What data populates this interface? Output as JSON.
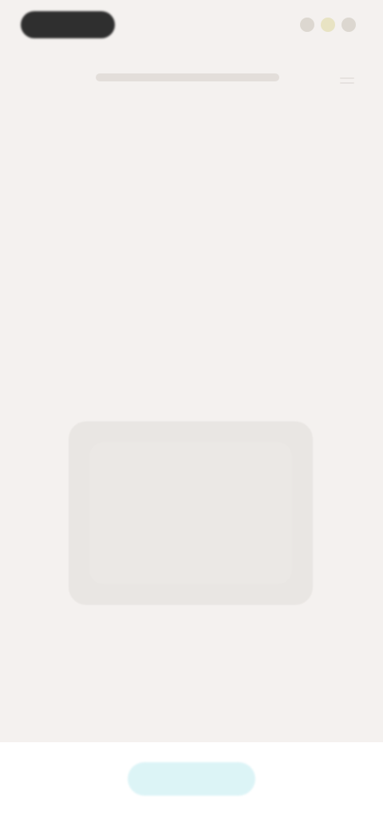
{
  "header": {
    "left_pill_label": "",
    "title": "",
    "right_icons": [
      "status-icon",
      "status-icon",
      "status-icon"
    ]
  },
  "hero": {
    "heading": "",
    "subheading": ""
  },
  "card": {
    "content": ""
  },
  "footer_links": {
    "left": "",
    "right": ""
  },
  "cta": {
    "label": ""
  },
  "colors": {
    "background": "#f4f1ef",
    "pill": "#2f2f2f",
    "card": "#e9e6e3",
    "link": "#9fb7c2",
    "cta_bg": "#d9f3f6",
    "cta_text": "#6fd7df"
  }
}
